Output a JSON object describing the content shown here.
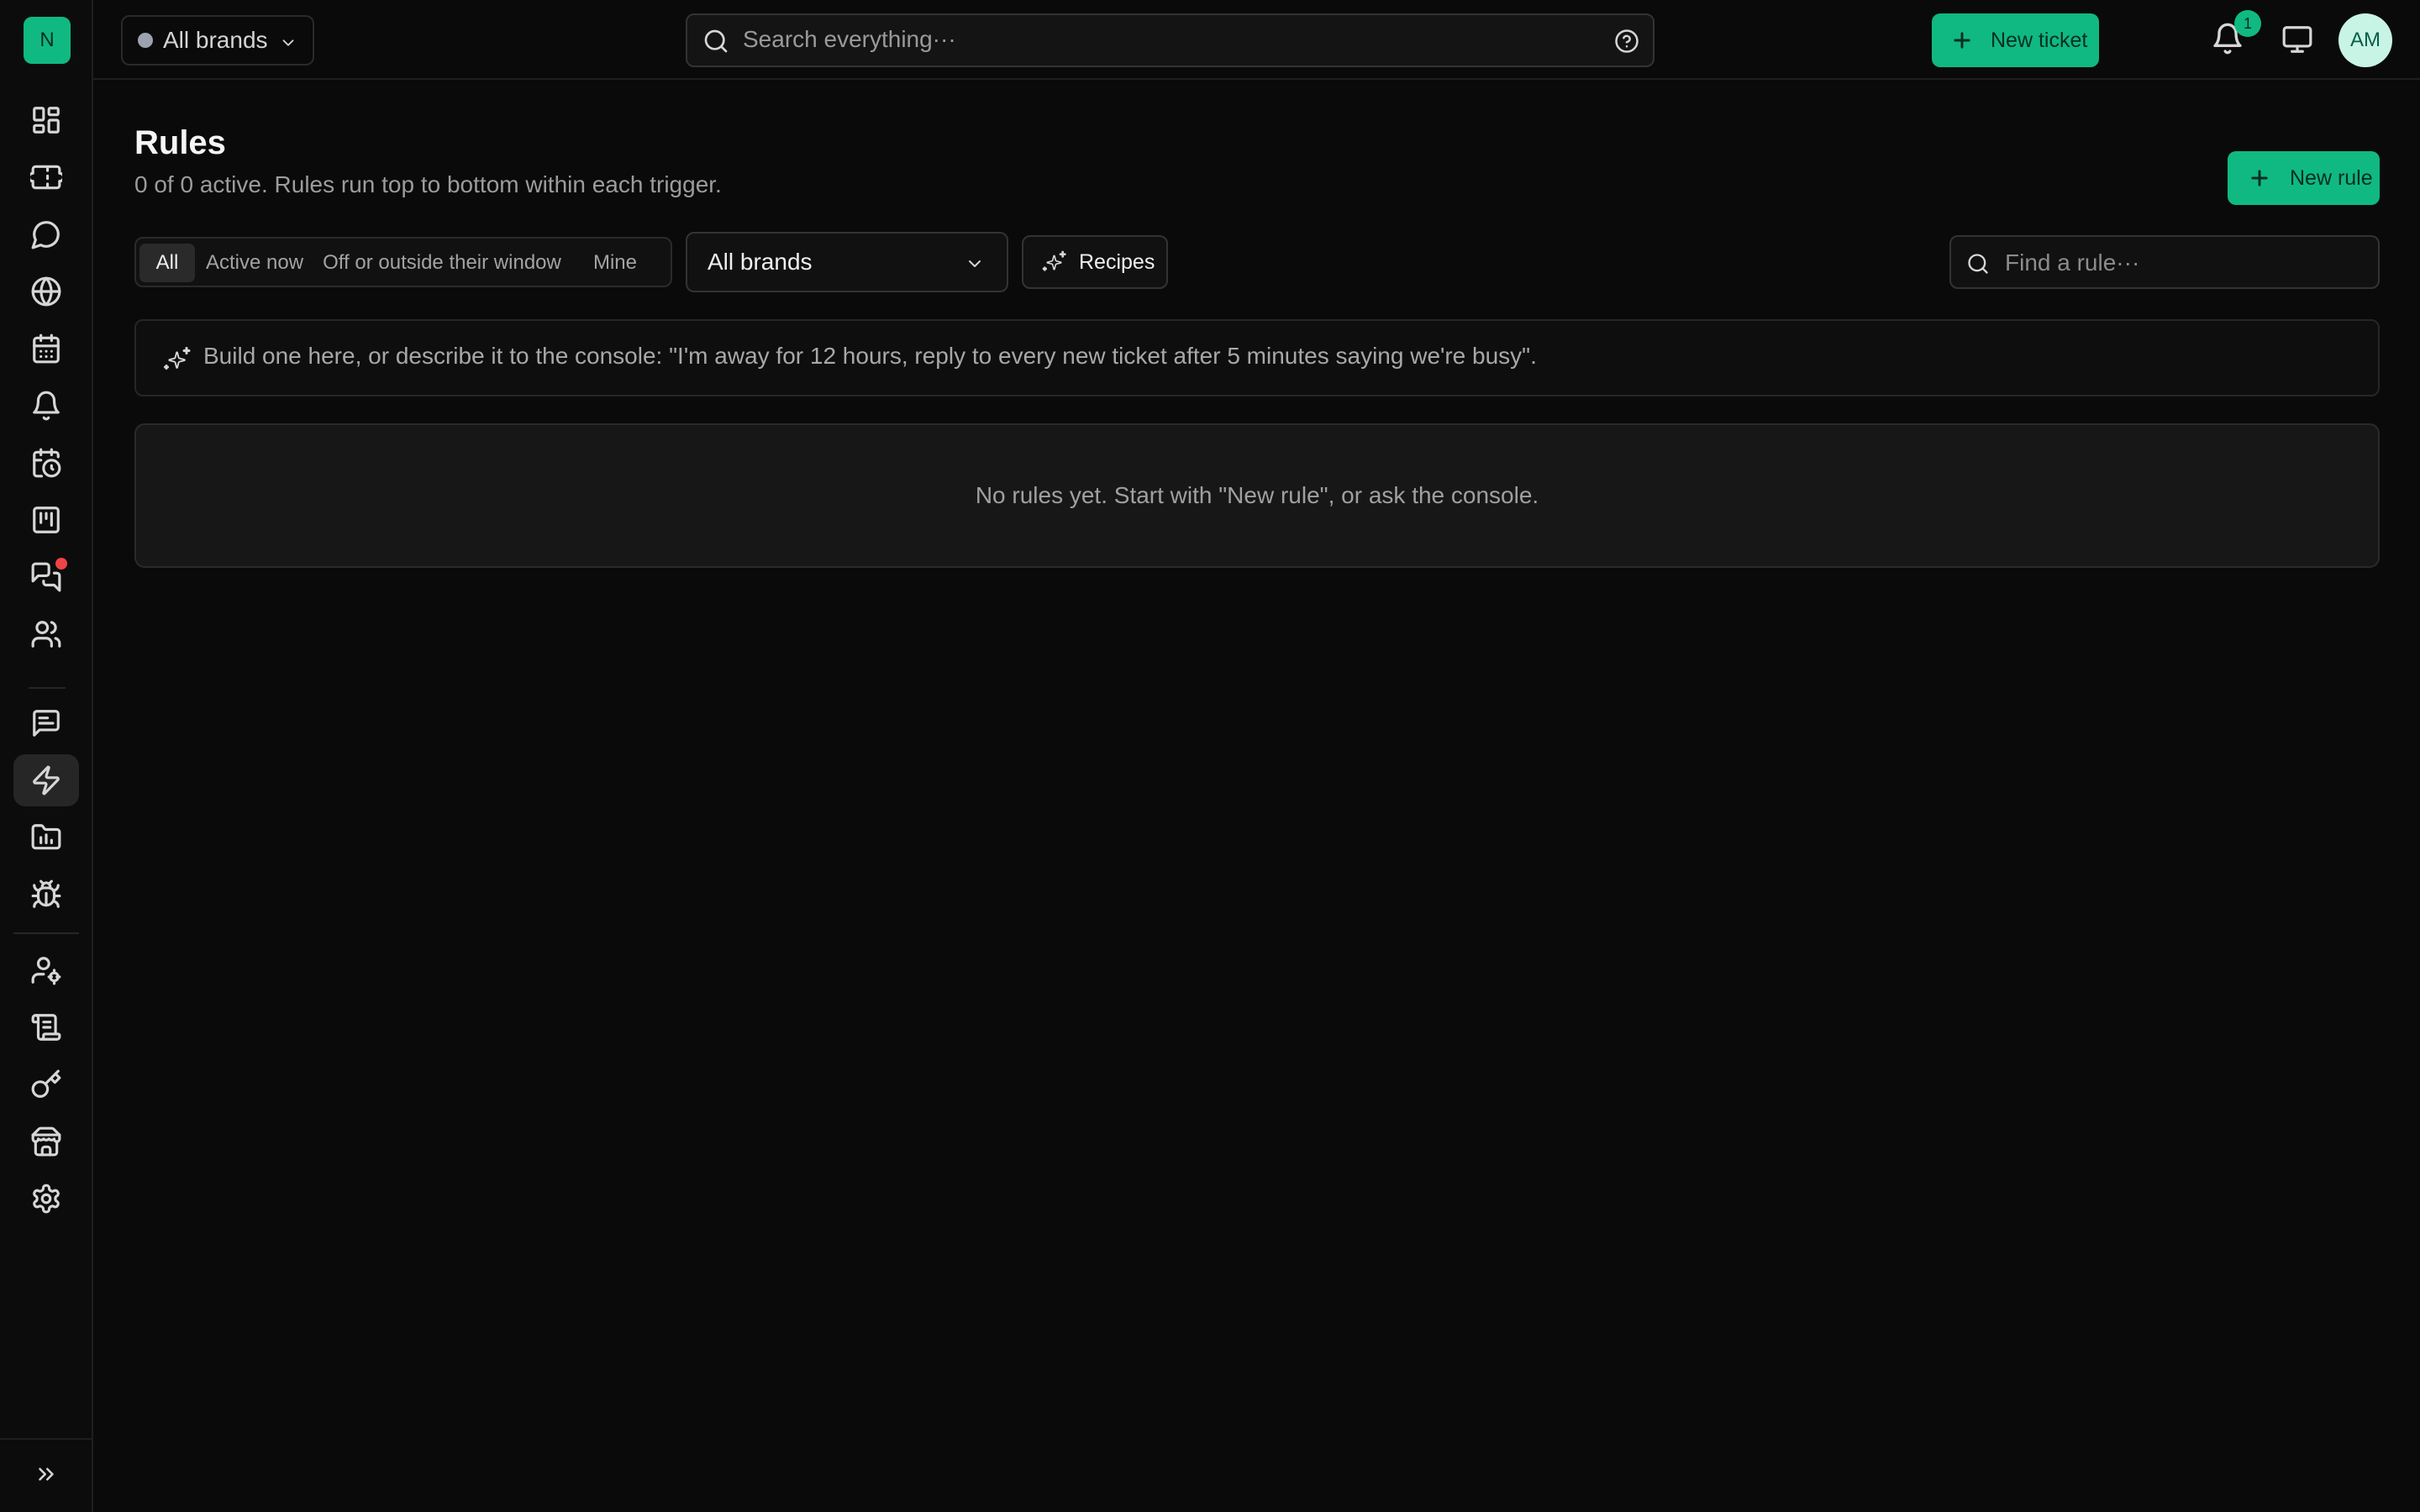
{
  "app": {
    "logo_letter": "N"
  },
  "sidebar": {
    "items": [
      {
        "name": "dashboard-icon"
      },
      {
        "name": "ticket-icon"
      },
      {
        "name": "chat-bubble-icon"
      },
      {
        "name": "globe-icon"
      },
      {
        "name": "calendar-icon"
      },
      {
        "name": "bell-icon"
      },
      {
        "name": "calendar-clock-icon"
      },
      {
        "name": "kanban-icon"
      },
      {
        "name": "messages-icon",
        "has_notification": true
      },
      {
        "name": "users-icon"
      },
      {
        "name": "message-square-text-icon"
      },
      {
        "name": "zap-icon",
        "active": true
      },
      {
        "name": "folder-chart-icon"
      },
      {
        "name": "bug-icon"
      },
      {
        "name": "user-cog-icon"
      },
      {
        "name": "scroll-icon"
      },
      {
        "name": "key-icon"
      },
      {
        "name": "store-icon"
      },
      {
        "name": "settings-icon"
      }
    ],
    "expand_icon": "chevrons-right-icon"
  },
  "topbar": {
    "brand_select": "All brands",
    "search_placeholder": "Search everything···",
    "new_ticket_label": "New ticket",
    "notification_count": "1",
    "avatar_initials": "AM"
  },
  "page": {
    "title": "Rules",
    "subtitle": "0 of 0 active. Rules run top to bottom within each trigger.",
    "new_rule_label": "New rule",
    "filters": [
      "All",
      "Active now",
      "Off or outside their window",
      "Mine"
    ],
    "active_filter": "All",
    "brand_filter": "All brands",
    "recipes_label": "Recipes",
    "find_placeholder": "Find a rule···",
    "hint": "Build one here, or describe it to the console: \"I'm away for 12 hours, reply to every new ticket after 5 minutes saying we're busy\".",
    "empty_message": "No rules yet. Start with \"New rule\", or ask the console."
  },
  "colors": {
    "accent": "#10b981",
    "background": "#0a0a0a",
    "notification_dot": "#ef4444"
  }
}
